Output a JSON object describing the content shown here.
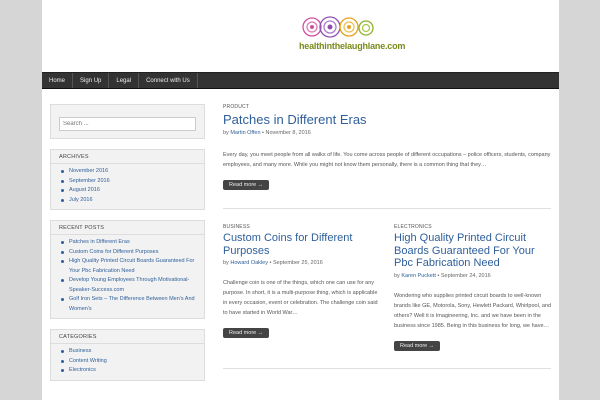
{
  "site": {
    "logo_text": "healthinthelaughlane.com"
  },
  "nav": [
    "Home",
    "Sign Up",
    "Legal",
    "Connect with Us"
  ],
  "sidebar": {
    "search_placeholder": "Search ...",
    "archives": {
      "title": "ARCHIVES",
      "items": [
        "November 2016",
        "September 2016",
        "August 2016",
        "July 2016"
      ]
    },
    "recent": {
      "title": "RECENT POSTS",
      "items": [
        "Patches in Different Eras",
        "Custom Coins for Different Purposes",
        "High Quality Printed Circuit Boards Guaranteed For Your Pbc Fabrication Need",
        "Develop Young Employees Through Motivational-Speaker-Success.com",
        "Golf Iron Sets – The Difference Between Men's And Women's"
      ]
    },
    "categories": {
      "title": "CATEGORIES",
      "items": [
        "Business",
        "Content Writing",
        "Electronics"
      ]
    }
  },
  "posts": [
    {
      "category": "PRODUCT",
      "title": "Patches in Different Eras",
      "by": "by",
      "author": "Martin Offen",
      "date": "November 8, 2016",
      "excerpt": "Every day, you meet people from all walks of life. You come across people of different occupations – police officers, students, company employees, and many more. While you might not know them personally, there is a common thing that they…",
      "readmore": "Read more →"
    },
    {
      "category": "BUSINESS",
      "title": "Custom Coins for Different Purposes",
      "by": "by",
      "author": "Howard Oakley",
      "date": "September 25, 2016",
      "excerpt": "Challenge coin is one of the things, which one can use for any purpose. In short, it is a multi-purpose thing, which is applicable in every occasion, event or celebration. The challenge coin said to have started in World War…",
      "readmore": "Read more →"
    },
    {
      "category": "ELECTRONICS",
      "title": "High Quality Printed Circuit Boards Guaranteed For Your Pbc Fabrication Need",
      "by": "by",
      "author": "Karen Puckett",
      "date": "September 24, 2016",
      "excerpt": "Wondering who supplies printed circuit boards to well-known brands like GE, Motorola, Sony, Hewlett Packard, Whirlpool, and others? Well it is Imagineering, Inc. and we have been in the business since 1985. Being in this business for long, we have…",
      "readmore": "Read more →"
    }
  ]
}
